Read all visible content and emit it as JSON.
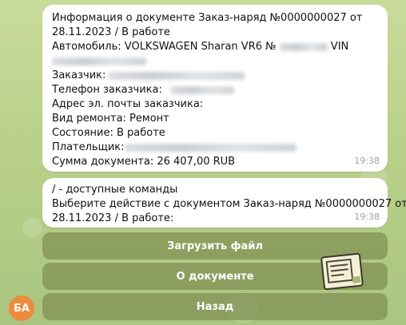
{
  "message1": {
    "lines": [
      "Информация о документе Заказ-наряд №0000000027  от",
      "28.11.2023 / В работе",
      "Автомобиль: VOLKSWAGEN Sharan VR6 №",
      "VIN",
      "Заказчик:",
      "Телефон заказчика:",
      "Адрес эл. почты заказчика:",
      "Вид ремонта: Ремонт",
      "Состояние: В работе",
      "Плательщик:",
      "Сумма документа: 26 407,00 RUB"
    ],
    "time": "19:38"
  },
  "message2": {
    "lines": [
      "/ - доступные команды",
      "Выберите действие с документом Заказ-наряд №0000000027  от",
      "28.11.2023 / В работе:"
    ],
    "time": "19:38"
  },
  "keyboard": {
    "upload": "Загрузить файл",
    "about": "О документе",
    "back": "Назад"
  },
  "avatar": {
    "initials": "БА",
    "color": "#ee8a3c"
  }
}
